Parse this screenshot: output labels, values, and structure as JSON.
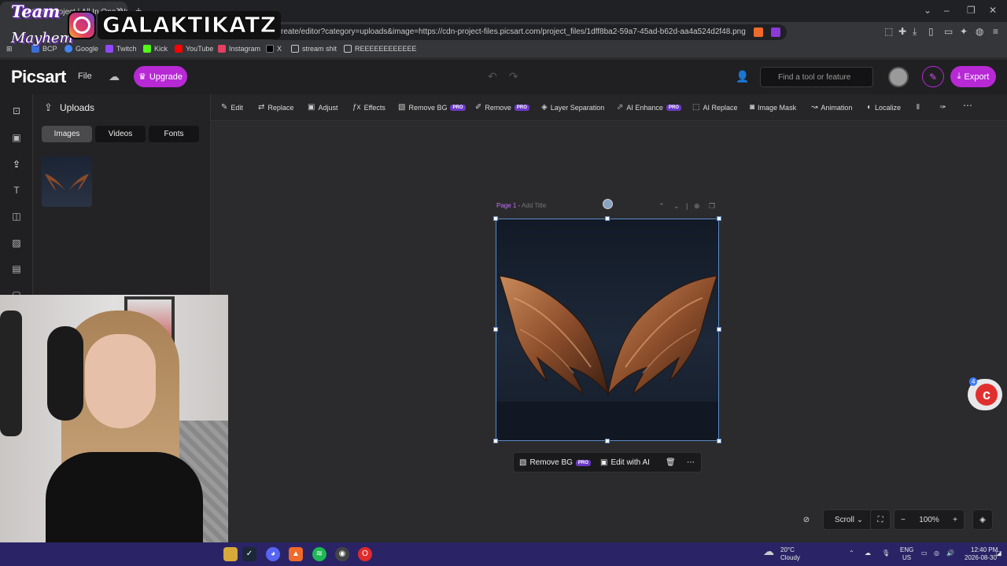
{
  "browser": {
    "tab_title": "Untitled Project | All In One We",
    "tab_close": "✕",
    "new_tab": "+",
    "url": "create/editor?category=uploads&image=https://cdn-project-files.picsart.com/project_files/1dff8ba2-59a7-45ad-b62d-aa4a524d2f48.png",
    "bookmarks": [
      {
        "label": "BCP",
        "color": "#3a6fd8"
      },
      {
        "label": "Google",
        "color": "#4285f4"
      },
      {
        "label": "Twitch",
        "color": "#9146ff"
      },
      {
        "label": "Kick",
        "color": "#53fc18"
      },
      {
        "label": "YouTube",
        "color": "#ff0000"
      },
      {
        "label": "Instagram",
        "color": "#e4405f"
      },
      {
        "label": "X",
        "color": "#000000"
      },
      {
        "label": "stream shit",
        "color": "#c8c8c8"
      },
      {
        "label": "REEEEEEEEEEEE",
        "color": "#c8c8c8"
      }
    ]
  },
  "overlay": {
    "team": "Team",
    "mayhem": "Mayhem",
    "handle": "GALAKTIKATZ"
  },
  "app": {
    "logo": "Picsart",
    "file_menu": "File",
    "upgrade": "Upgrade",
    "search_placeholder": "Find a tool or feature",
    "export": "Export",
    "accent_color": "#b829d6"
  },
  "uploads_panel": {
    "title": "Uploads",
    "segments": [
      "Images",
      "Videos",
      "Fonts"
    ],
    "active_segment": "Images"
  },
  "toolbar": {
    "tools": [
      {
        "label": "Edit",
        "icon": "edit-icon",
        "pro": false
      },
      {
        "label": "Replace",
        "icon": "replace-icon",
        "pro": false
      },
      {
        "label": "Adjust",
        "icon": "adjust-icon",
        "pro": false
      },
      {
        "label": "Effects",
        "icon": "effects-icon",
        "pro": false
      },
      {
        "label": "Remove BG",
        "icon": "remove-bg-icon",
        "pro": true
      },
      {
        "label": "Remove",
        "icon": "remove-icon",
        "pro": true
      },
      {
        "label": "Layer Separation",
        "icon": "layers-icon",
        "pro": false
      },
      {
        "label": "AI Enhance",
        "icon": "ai-enhance-icon",
        "pro": true
      },
      {
        "label": "AI Replace",
        "icon": "ai-replace-icon",
        "pro": false
      },
      {
        "label": "Image Mask",
        "icon": "mask-icon",
        "pro": false
      },
      {
        "label": "Animation",
        "icon": "animation-icon",
        "pro": false
      },
      {
        "label": "Localize",
        "icon": "globe-icon",
        "pro": false
      }
    ],
    "pro_badge": "PRO"
  },
  "page": {
    "label": "Page 1",
    "separator": " - ",
    "add_title": "Add Title"
  },
  "context_bar": {
    "remove_bg": "Remove BG",
    "pro_badge": "PRO",
    "edit_with_ai": "Edit with AI"
  },
  "bottom": {
    "scroll": "Scroll",
    "zoom": "100%",
    "help_badge": "4"
  },
  "taskbar": {
    "weather_temp": "20°C",
    "weather_desc": "Cloudy",
    "lang": "ENG",
    "region": "US",
    "time": "12:40 PM",
    "date": "2026-08-30"
  }
}
